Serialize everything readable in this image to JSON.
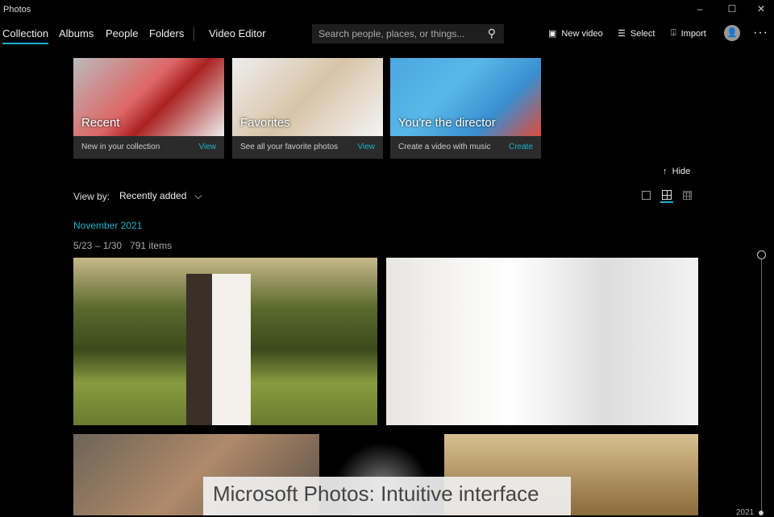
{
  "app": {
    "title": "Photos"
  },
  "window": {
    "minimize": "–",
    "maximize": "☐",
    "close": "✕"
  },
  "nav": {
    "tabs": [
      "Collection",
      "Albums",
      "People",
      "Folders",
      "Video Editor"
    ],
    "active": "Collection"
  },
  "search": {
    "placeholder": "Search people, places, or things..."
  },
  "toolbar": {
    "new_video": "New video",
    "select": "Select",
    "import": "Import",
    "more": "···"
  },
  "cards": [
    {
      "title": "Recent",
      "subtitle": "New in your collection",
      "action": "View"
    },
    {
      "title": "Favorites",
      "subtitle": "See all your favorite photos",
      "action": "View"
    },
    {
      "title": "You're the director",
      "subtitle": "Create a video with music",
      "action": "Create"
    }
  ],
  "hide_label": "Hide",
  "view_by": {
    "label": "View by:",
    "value": "Recently added"
  },
  "group": {
    "month": "November 2021",
    "range": "5/23 – 1/30",
    "count": "791 items"
  },
  "timeline": {
    "year": "2021"
  },
  "caption": "Microsoft Photos: Intuitive interface",
  "colors": {
    "accent": "#1ab3c8"
  }
}
